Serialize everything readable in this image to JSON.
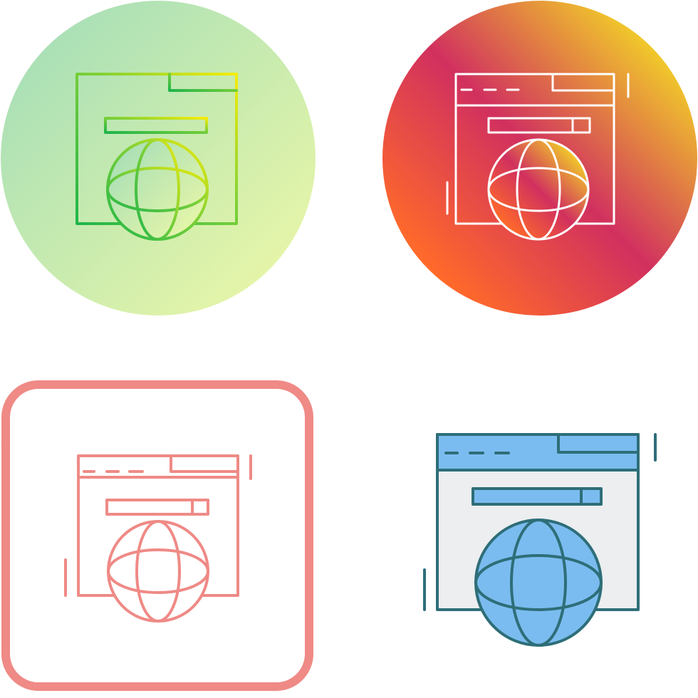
{
  "icons": [
    {
      "variant": "gradient-outline-on-gradient-circle",
      "icon": "browser-globe-icon",
      "background_colors": [
        "#9fdcb9",
        "#f0f9a6"
      ],
      "stroke_colors": [
        "#1fb54a",
        "#f5ec0a"
      ]
    },
    {
      "variant": "white-outline-on-gradient-circle",
      "icon": "browser-globe-icon",
      "background_colors": [
        "#f9f21c",
        "#d1305f",
        "#ff6a2a"
      ],
      "stroke_color": "#ffffff"
    },
    {
      "variant": "outline-in-rounded-square",
      "icon": "browser-globe-icon",
      "frame_color": "#ef8a86",
      "stroke_color": "#ef8a86"
    },
    {
      "variant": "filled-color",
      "icon": "browser-globe-icon",
      "window_fill": "#eceef0",
      "header_fill": "#7bbcf0",
      "globe_fill": "#7bbcf0",
      "stroke_color": "#2e6e78"
    }
  ]
}
